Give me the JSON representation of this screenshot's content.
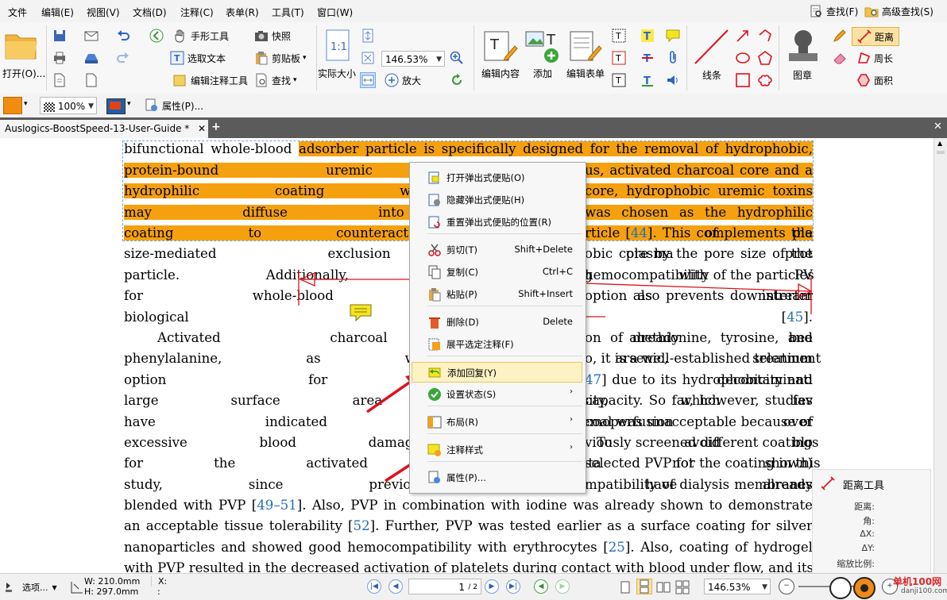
{
  "menu": {
    "items": [
      "文件",
      "编辑(E)",
      "视图(V)",
      "文档(D)",
      "注释(C)",
      "表单(R)",
      "工具(T)",
      "窗口(W)"
    ],
    "find": "查找(F)",
    "adv_find": "高级查找(S)"
  },
  "ribbon": {
    "open": "打开(O)...",
    "hand_tool": "手形工具",
    "select_text": "选取文本",
    "edit_annot_tool": "编辑注释工具",
    "snapshot": "快照",
    "clipboard": "剪贴板",
    "find": "查找",
    "actual_size": "实际大小",
    "zoom_value": "146.53%",
    "zoom_in": "放大",
    "zoom_out": "缩小",
    "edit_content": "编辑内容",
    "add": "添加",
    "edit_form": "编辑表单",
    "lines": "线条",
    "stamp": "图章",
    "distance": "距离",
    "perimeter": "周长",
    "area": "面积"
  },
  "propbar": {
    "opacity": "100%",
    "properties": "属性(P)..."
  },
  "tab": {
    "title": "Auslogics-BoostSpeed-13-User-Guide *"
  },
  "document": {
    "lines": [
      {
        "pre": "bifunctional whole-blood ",
        "hl": "adsorber particle is specifically designed for the removal of hydrophobic,",
        "post": ""
      },
      {
        "pre": "",
        "hl": "protein-bound uremic toxins and consists",
        "post": ""
      },
      {
        "pre": "",
        "hl": "hydrophilic coating with PVP. Due to th",
        "post": ""
      },
      {
        "pre": "",
        "hl": "may diffuse into the activated charcoa",
        "post": ""
      },
      {
        "pre": "",
        "hl": "coating to counteract the binding of pla",
        "post": ""
      },
      {
        "pre": "size-mediated exclusion of plasma prot",
        "hl": "",
        "post": ""
      },
      {
        "pre": "particle. Additionally, the coating with PV",
        "hl": "",
        "post": ""
      },
      {
        "pre": "for whole-blood applications, as interfer",
        "hl": "",
        "post": ""
      },
      {
        "pre": "biological reactions [",
        "cite": "45",
        "post": "]."
      },
      {
        "pre": "Activated charcoal has already bee",
        "hl": "",
        "post": ""
      },
      {
        "pre": "phenylalanine, as well as arsenic, selenium",
        "hl": "",
        "post": ""
      },
      {
        "pre": "option for gastrointestinal decontaminati",
        "hl": "",
        "post": ""
      },
      {
        "pre": "large surface area and porosity, which fav",
        "hl": "",
        "post": ""
      },
      {
        "pre": "have indicated that hemoperfusion over",
        "hl": "",
        "post": ""
      },
      {
        "pre": "excessive blood damage [",
        "cite": "48",
        "post": "]. To avoid blo"
      },
      {
        "pre": "for the activated charcoal (data not shown)",
        "hl": "",
        "post": ""
      },
      {
        "pre": "study, since previous studies have already",
        "hl": "",
        "post": ""
      },
      {
        "pre": "blended with PVP [",
        "cite": "49–51",
        "post": "].  Also, PVP in combination with iodine was already shown to demonstrate"
      },
      {
        "pre": "an acceptable tissue tolerability [",
        "cite": "52",
        "post": "].  Further, PVP was tested earlier as a surface coating for silver"
      },
      {
        "pre": "nanoparticles and showed good hemocompatibility with erythrocytes [",
        "cite": "25",
        "post": "].  Also, coating of hydrogel"
      },
      {
        "pre": "with PVP resulted in the decreased activation of platelets during contact with blood under flow, and its",
        "hl": "",
        "post": ""
      }
    ],
    "right_fragments": [
      {
        "text": "us, activated charcoal core and a",
        "hl": true
      },
      {
        "text": "core, hydrophobic uremic toxins",
        "hl": true
      },
      {
        "text": "was chosen as the hydrophilic",
        "hl": true
      },
      {
        "text": "rticle [",
        "hl": true,
        "cite": "44",
        "tail": "]. This complements the"
      },
      {
        "text": "obic core by the pore size of the",
        "hl": false
      },
      {
        "text": "hemocompatibility of the particles",
        "hl": false
      },
      {
        "text": "option also prevents downstream",
        "hl": false
      },
      {
        "text": "on of methionine, tyrosine, and",
        "hl": false
      },
      {
        "text": "o, it is a well-established treatment",
        "hl": false
      },
      {
        "text": "47",
        "cite_only": true,
        "tail": "] due to its hydrophobicity and"
      },
      {
        "text": "capacity. So far, however, studies",
        "hl": false
      },
      {
        "text": "coal was unacceptable because of",
        "hl": false
      },
      {
        "text": "viously screened different coatings",
        "hl": false
      },
      {
        "text": "selected PVP for the coating in this",
        "hl": false
      },
      {
        "text": "mpatibility of dialysis membranes",
        "hl": false
      }
    ]
  },
  "context_menu": {
    "items": [
      {
        "label": "打开弹出式便贴(O)",
        "shortcut": "",
        "icon": "note-open-icon"
      },
      {
        "label": "隐藏弹出式便贴(H)",
        "shortcut": "",
        "icon": "note-hide-icon"
      },
      {
        "label": "重置弹出式便贴的位置(R)",
        "shortcut": "",
        "icon": "note-reset-icon"
      },
      {
        "label": "剪切(T)",
        "shortcut": "Shift+Delete",
        "icon": "scissors-icon"
      },
      {
        "label": "复制(C)",
        "shortcut": "Ctrl+C",
        "icon": "copy-icon"
      },
      {
        "label": "粘贴(P)",
        "shortcut": "Shift+Insert",
        "icon": "paste-icon"
      },
      {
        "label": "删除(D)",
        "shortcut": "Delete",
        "icon": "trash-icon"
      },
      {
        "label": "展平选定注释(F)",
        "shortcut": "",
        "icon": "flatten-icon"
      },
      {
        "label": "添加回复(Y)",
        "shortcut": "",
        "icon": "reply-icon"
      },
      {
        "label": "设置状态(S)",
        "shortcut": "",
        "icon": "status-check-icon"
      },
      {
        "label": "布局(R)",
        "shortcut": "",
        "icon": "layout-icon"
      },
      {
        "label": "注释样式",
        "shortcut": "",
        "icon": "annotation-style-icon"
      },
      {
        "label": "属性(P)...",
        "shortcut": "",
        "icon": "properties-icon"
      }
    ]
  },
  "distance_panel": {
    "title": "距离工具",
    "rows": [
      "距离:",
      "角:",
      "ΔX:",
      "ΔY:",
      "缩放比例:"
    ]
  },
  "status": {
    "options": "选项...",
    "width": "W: 210.0mm",
    "height": "H: 297.0mm",
    "x": "X:",
    "y": ":",
    "page": "1",
    "page_total": "/ 2",
    "zoom": "146.53%",
    "watermark": "单机100网",
    "watermark_url": "danji100.com"
  },
  "colors": {
    "highlight": "#f5a10f",
    "citation": "#2470b3",
    "ink_red": "#e0101a",
    "menu_hover": "#fcf2c4"
  }
}
